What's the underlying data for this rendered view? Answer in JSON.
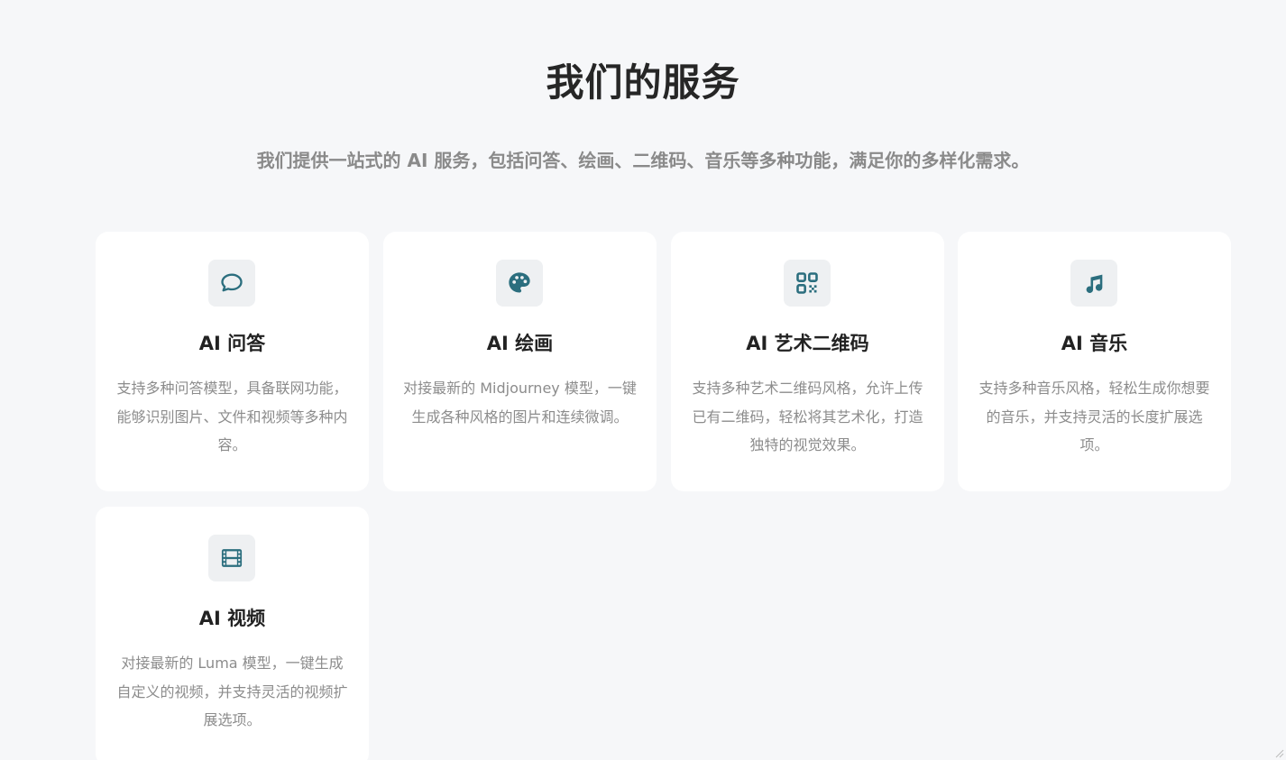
{
  "header": {
    "title": "我们的服务",
    "subtitle": "我们提供一站式的 AI 服务，包括问答、绘画、二维码、音乐等多种功能，满足你的多样化需求。"
  },
  "accent_color": "#2b6e7e",
  "services": [
    {
      "icon": "chat-bubble-icon",
      "title": "AI 问答",
      "description": "支持多种问答模型，具备联网功能，能够识别图片、文件和视频等多种内容。"
    },
    {
      "icon": "palette-icon",
      "title": "AI 绘画",
      "description": "对接最新的 Midjourney 模型，一键生成各种风格的图片和连续微调。"
    },
    {
      "icon": "qr-code-icon",
      "title": "AI 艺术二维码",
      "description": "支持多种艺术二维码风格，允许上传已有二维码，轻松将其艺术化，打造独特的视觉效果。"
    },
    {
      "icon": "music-note-icon",
      "title": "AI 音乐",
      "description": "支持多种音乐风格，轻松生成你想要的音乐，并支持灵活的长度扩展选项。"
    },
    {
      "icon": "film-icon",
      "title": "AI 视频",
      "description": "对接最新的 Luma 模型，一键生成自定义的视频，并支持灵活的视频扩展选项。"
    }
  ]
}
